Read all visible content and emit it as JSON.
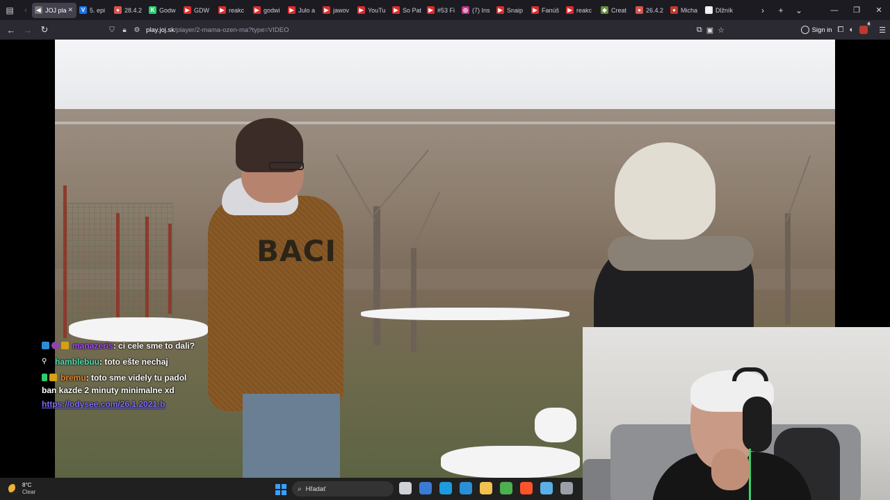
{
  "tabstrip": {
    "tabs": [
      {
        "label": "JOJ pla",
        "color": "#777",
        "glyph": "◀",
        "active": true
      },
      {
        "label": "5. epi",
        "color": "#1a73e8",
        "glyph": "V"
      },
      {
        "label": "28.4.2",
        "color": "#d9534f",
        "glyph": "●"
      },
      {
        "label": "Godw",
        "color": "#2ecc71",
        "glyph": "K"
      },
      {
        "label": "GDW",
        "color": "#e02b2b",
        "glyph": "▶"
      },
      {
        "label": "reakc",
        "color": "#e02b2b",
        "glyph": "▶"
      },
      {
        "label": "godwi",
        "color": "#e02b2b",
        "glyph": "▶"
      },
      {
        "label": "Julo a",
        "color": "#e02b2b",
        "glyph": "▶"
      },
      {
        "label": "jawov",
        "color": "#e02b2b",
        "glyph": "▶"
      },
      {
        "label": "YouTu",
        "color": "#e02b2b",
        "glyph": "▶"
      },
      {
        "label": "So Pat",
        "color": "#e02b2b",
        "glyph": "▶"
      },
      {
        "label": "#53 Fi",
        "color": "#e02b2b",
        "glyph": "▶"
      },
      {
        "label": "(7) Ins",
        "color": "#c13584",
        "glyph": "◎"
      },
      {
        "label": "Snaip",
        "color": "#e02b2b",
        "glyph": "▶"
      },
      {
        "label": "Fanúš",
        "color": "#e02b2b",
        "glyph": "▶"
      },
      {
        "label": "reakc",
        "color": "#e02b2b",
        "glyph": "▶"
      },
      {
        "label": "Creat",
        "color": "#6a8f3c",
        "glyph": "◆"
      },
      {
        "label": "26.4.2",
        "color": "#d9534f",
        "glyph": "●"
      },
      {
        "label": "Micha",
        "color": "#c0392b",
        "glyph": "●"
      },
      {
        "label": "Dlžník",
        "color": "#eee",
        "glyph": "D"
      }
    ]
  },
  "navbar": {
    "url_host": "play.joj.sk",
    "url_path": "/player/2-mama-ozen-ma?type=VIDEO",
    "signin_label": "Sign in",
    "extension_badge": "4"
  },
  "video": {
    "sweater_print": "BACI"
  },
  "chat": {
    "messages": [
      {
        "user": "manazeris",
        "user_color": "#a64dff",
        "text": ": ci cele sme to dali?",
        "badges": [
          "blue",
          "purple",
          "gold"
        ]
      },
      {
        "user": "hamblebuu",
        "user_color": "#4fe0b5",
        "text": ": toto ešte nechaj",
        "badges": [
          "gray"
        ]
      },
      {
        "user": "bremu",
        "user_color": "#e08a2e",
        "text": ": toto sme videly tu padol",
        "badges": [
          "green",
          "gold"
        ]
      }
    ],
    "continuation": "ban kazde 2 minuty minimalne xd",
    "link": "https://odysee.com/26.1.2021:b"
  },
  "taskbar": {
    "temperature": "8°C",
    "condition": "Clear",
    "search_placeholder": "Hľadať",
    "apps": [
      {
        "name": "task-view",
        "color": "#cfd3d8"
      },
      {
        "name": "store",
        "color": "#3a7bd5"
      },
      {
        "name": "edge",
        "color": "#1e9be0"
      },
      {
        "name": "photos",
        "color": "#2a8fd6"
      },
      {
        "name": "explorer",
        "color": "#f2c14e"
      },
      {
        "name": "chrome",
        "color": "#4caf50"
      },
      {
        "name": "brave",
        "color": "#fb542b"
      },
      {
        "name": "notepad",
        "color": "#5ab0e6"
      },
      {
        "name": "settings",
        "color": "#9aa0a6"
      }
    ]
  }
}
